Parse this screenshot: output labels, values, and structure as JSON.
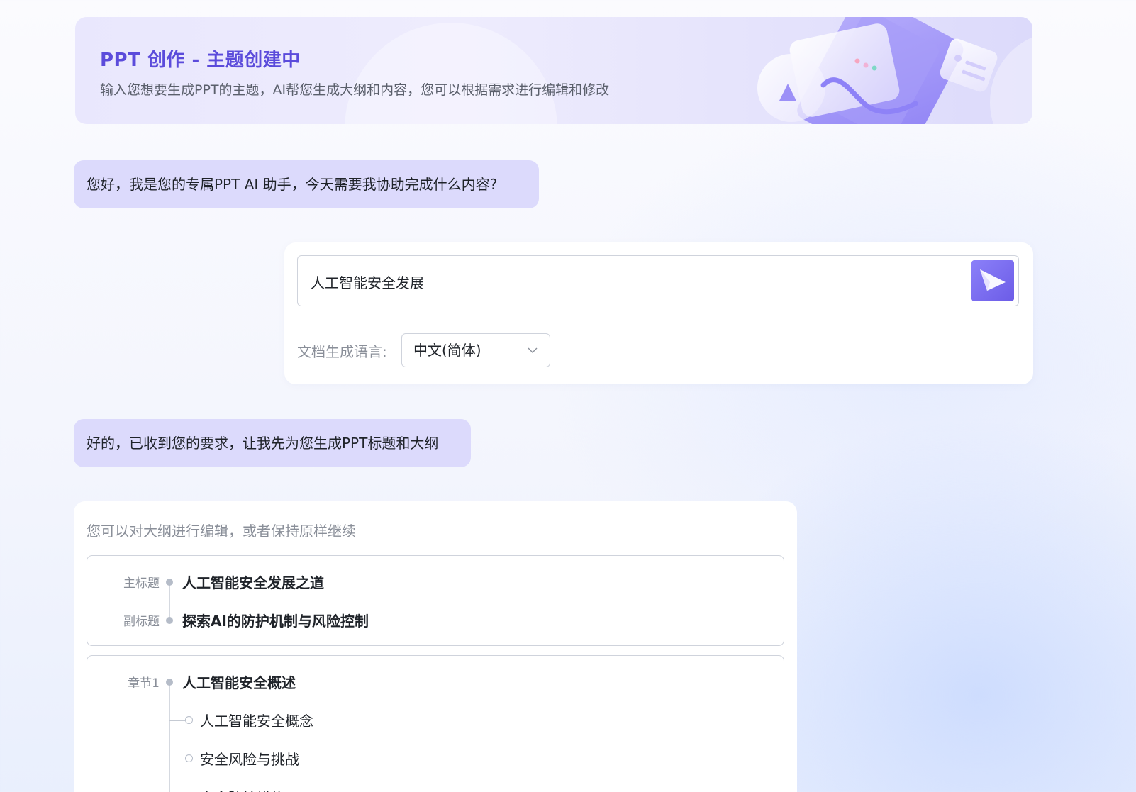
{
  "header": {
    "title": "PPT 创作 - 主题创建中",
    "subtitle": "输入您想要生成PPT的主题，AI帮您生成大纲和内容，您可以根据需求进行编辑和修改"
  },
  "chat": {
    "greeting": "您好，我是您的专属PPT AI 助手，今天需要我协助完成什么内容?",
    "ack": "好的，已收到您的要求，让我先为您生成PPT标题和大纲"
  },
  "input": {
    "topic_value": "人工智能安全发展",
    "send_icon": "send-icon",
    "language_label": "文档生成语言:",
    "language_value": "中文(简体)"
  },
  "outline": {
    "hint": "您可以对大纲进行编辑，或者保持原样继续",
    "main_title_label": "主标题",
    "main_title": "人工智能安全发展之道",
    "subtitle_label": "副标题",
    "subtitle": "探索AI的防护机制与风险控制",
    "chapters": [
      {
        "label": "章节1",
        "title": "人工智能安全概述",
        "items": [
          "人工智能安全概念",
          "安全风险与挑战",
          "安全防护措施"
        ]
      }
    ]
  },
  "colors": {
    "accent": "#6c5ce7",
    "title_purple": "#5b4bdb",
    "bubble_bg": "#dcdafc"
  }
}
